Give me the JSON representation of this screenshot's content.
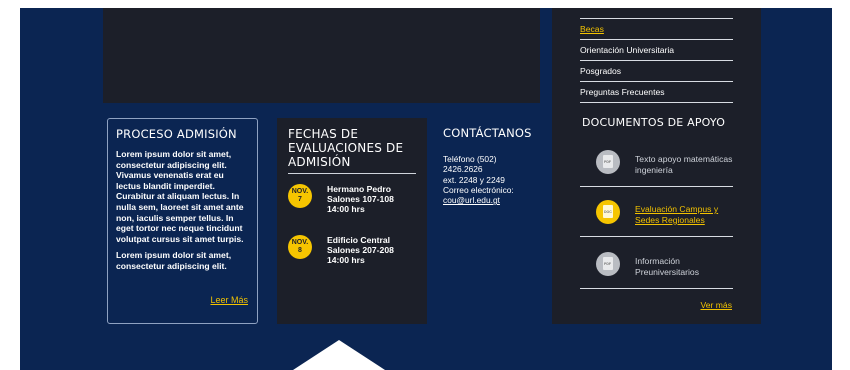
{
  "admision": {
    "title": "PROCESO ADMISIÓN",
    "p1": "Lorem ipsum dolor sit amet, consectetur adipiscing elit. Vivamus venenatis erat eu lectus blandit imperdiet. Curabitur at aliquam lectus. In nulla sem, laoreet sit amet ante non, iaculis semper tellus. In eget tortor nec neque tincidunt volutpat cursus sit amet turpis.",
    "p2": "Lorem ipsum dolor sit amet, consectetur adipiscing elit.",
    "link": "Leer Más"
  },
  "fechas": {
    "title": "FECHAS DE EVALUACIONES DE ADMISIÓN",
    "events": [
      {
        "month": "NOV.",
        "day": "7",
        "place": "Hermano Pedro",
        "rooms": "Salones 107-108",
        "time": "14:00 hrs"
      },
      {
        "month": "NOV.",
        "day": "8",
        "place": "Edificio Central",
        "rooms": "Salones 207-208",
        "time": "14:00 hrs"
      }
    ]
  },
  "contacto": {
    "title": "CONTÁCTANOS",
    "phone_label": "Teléfono (502)",
    "phone": "2426.2626",
    "ext": "ext. 2248 y 2249",
    "email_label": "Correo electrónico:",
    "email": "cou@url.edu.gt"
  },
  "panel": {
    "links": [
      "Becas",
      "Orientación Universitaria",
      "Posgrados",
      "Preguntas Frecuentes"
    ],
    "docs_title": "DOCUMENTOS DE APOYO",
    "docs": [
      {
        "label": "Texto apoyo matemáticas ingeniería",
        "icon": "PDF"
      },
      {
        "label": "Evaluación Campus y Sedes Regionales",
        "icon": "DOC"
      },
      {
        "label": "Información Preuniversitarios",
        "icon": "PDF"
      }
    ],
    "more": "Ver más"
  },
  "colors": {
    "navy": "#0b2552",
    "dark": "#1c1f29",
    "accent": "#f6c500"
  }
}
